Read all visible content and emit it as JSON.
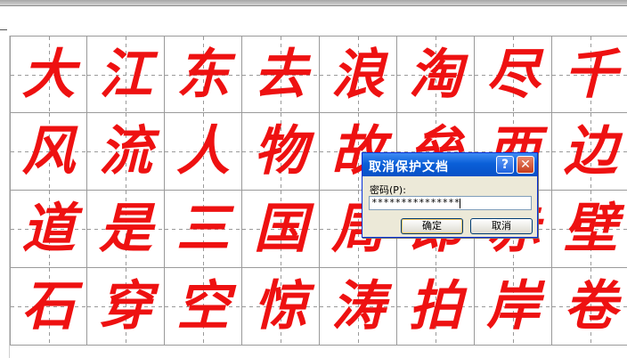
{
  "grid": {
    "rows": [
      [
        "大",
        "江",
        "东",
        "去",
        "浪",
        "淘",
        "尽",
        "千"
      ],
      [
        "风",
        "流",
        "人",
        "物",
        "故",
        "垒",
        "西",
        "边"
      ],
      [
        "道",
        "是",
        "三",
        "国",
        "周",
        "郎",
        "赤",
        "壁"
      ],
      [
        "石",
        "穿",
        "空",
        "惊",
        "涛",
        "拍",
        "岸",
        "卷"
      ]
    ],
    "ink_color": "#ee1111"
  },
  "dialog": {
    "title": "取消保护文档",
    "help_glyph": "?",
    "close_glyph": "✕",
    "password_label": "密码(P):",
    "password_value": "***************",
    "ok_label": "确定",
    "cancel_label": "取消"
  }
}
